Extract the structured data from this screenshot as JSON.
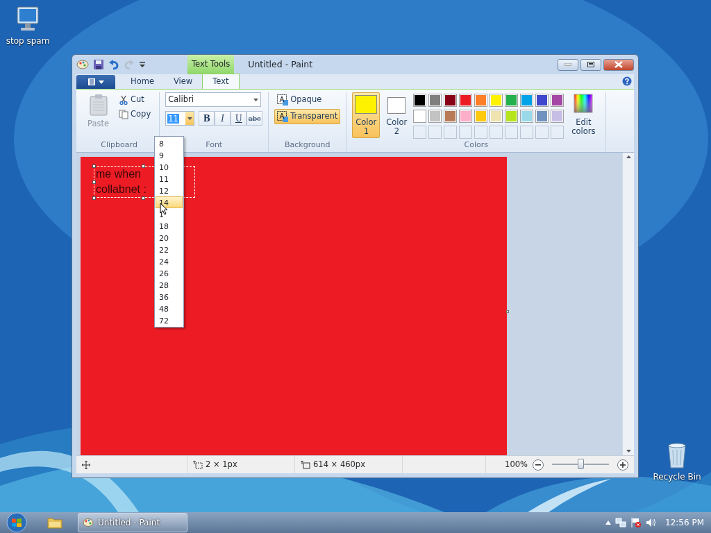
{
  "desktop_icons": [
    {
      "label": "stop spam",
      "kind": "computer"
    },
    {
      "label": "Recycle Bin",
      "kind": "recycle"
    }
  ],
  "window": {
    "title": "Untitled - Paint",
    "context_tab": "Text Tools"
  },
  "ribbon_tabs": [
    {
      "label": "Home",
      "selected": false
    },
    {
      "label": "View",
      "selected": false
    },
    {
      "label": "Text",
      "selected": true
    }
  ],
  "clipboard": {
    "paste": "Paste",
    "cut": "Cut",
    "copy": "Copy",
    "group": "Clipboard"
  },
  "font": {
    "family": "Calibri",
    "size": "11",
    "group": "Font",
    "styles": [
      {
        "label": "B",
        "kind": "bold"
      },
      {
        "label": "I",
        "kind": "italic"
      },
      {
        "label": "U",
        "kind": "underline"
      },
      {
        "label": "abc",
        "kind": "strike"
      }
    ]
  },
  "background": {
    "group": "Background",
    "options": [
      {
        "label": "Opaque",
        "selected": false
      },
      {
        "label": "Transparent",
        "selected": true
      }
    ]
  },
  "colors": {
    "group": "Colors",
    "edit": "Edit colors",
    "current": [
      {
        "label": "Color 1",
        "color": "#fff200",
        "selected": true
      },
      {
        "label": "Color 2",
        "color": "#ffffff",
        "selected": false
      }
    ],
    "palette": [
      {
        "color": "#000000"
      },
      {
        "color": "#7f7f7f"
      },
      {
        "color": "#880015"
      },
      {
        "color": "#ed1c24"
      },
      {
        "color": "#ff7f27"
      },
      {
        "color": "#fff200"
      },
      {
        "color": "#22b14c"
      },
      {
        "color": "#00a2e8"
      },
      {
        "color": "#3f48cc"
      },
      {
        "color": "#a349a4"
      },
      {
        "color": "#ffffff"
      },
      {
        "color": "#c3c3c3"
      },
      {
        "color": "#b97a57"
      },
      {
        "color": "#ffaec9"
      },
      {
        "color": "#ffc90e"
      },
      {
        "color": "#efe4b0"
      },
      {
        "color": "#b5e61d"
      },
      {
        "color": "#99d9ea"
      },
      {
        "color": "#7092be"
      },
      {
        "color": "#c8bfe7"
      }
    ]
  },
  "canvas": {
    "lines": [
      "me when",
      "collabnet :"
    ]
  },
  "size_dropdown": [
    {
      "label": "8",
      "selected": false
    },
    {
      "label": "9",
      "selected": false
    },
    {
      "label": "10",
      "selected": false
    },
    {
      "label": "11",
      "selected": false
    },
    {
      "label": "12",
      "selected": false
    },
    {
      "label": "14",
      "selected": true
    },
    {
      "label": "1",
      "selected": false
    },
    {
      "label": "18",
      "selected": false
    },
    {
      "label": "20",
      "selected": false
    },
    {
      "label": "22",
      "selected": false
    },
    {
      "label": "24",
      "selected": false
    },
    {
      "label": "26",
      "selected": false
    },
    {
      "label": "28",
      "selected": false
    },
    {
      "label": "36",
      "selected": false
    },
    {
      "label": "48",
      "selected": false
    },
    {
      "label": "72",
      "selected": false
    }
  ],
  "status_bar": {
    "selection": "2 × 1px",
    "canvas_size": "614 × 460px",
    "zoom": "100%",
    "level": 0.5
  },
  "taskbar": {
    "task": "Untitled - Paint",
    "clock": "12:56 PM"
  }
}
